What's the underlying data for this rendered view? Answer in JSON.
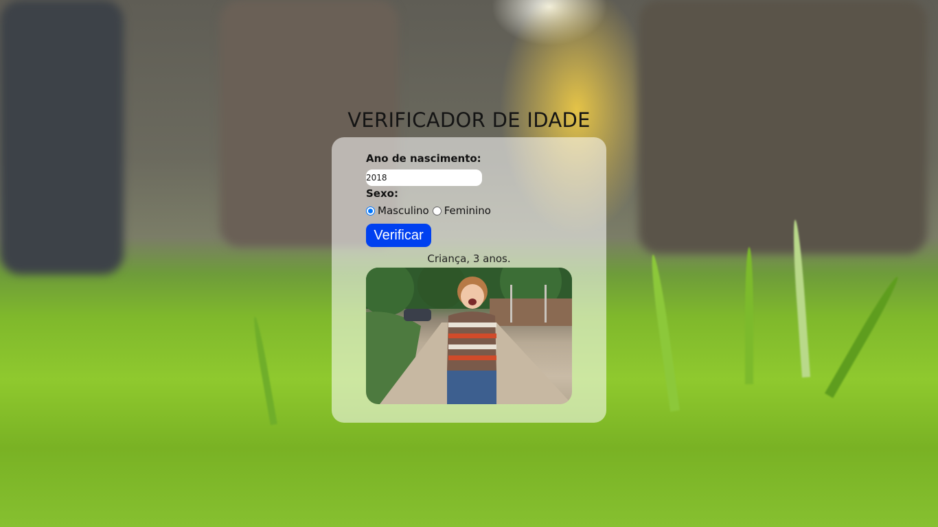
{
  "page": {
    "title": "VERIFICADOR DE IDADE"
  },
  "form": {
    "year_label": "Ano de nascimento:",
    "year_value": "2018",
    "sex_label": "Sexo:",
    "sex_options": [
      {
        "label": "Masculino",
        "checked": true
      },
      {
        "label": "Feminino",
        "checked": false
      }
    ],
    "submit_label": "Verificar"
  },
  "result": {
    "text": "Criança, 3 anos."
  },
  "colors": {
    "button": "#0040f0",
    "radio_accent": "#0075ff"
  }
}
